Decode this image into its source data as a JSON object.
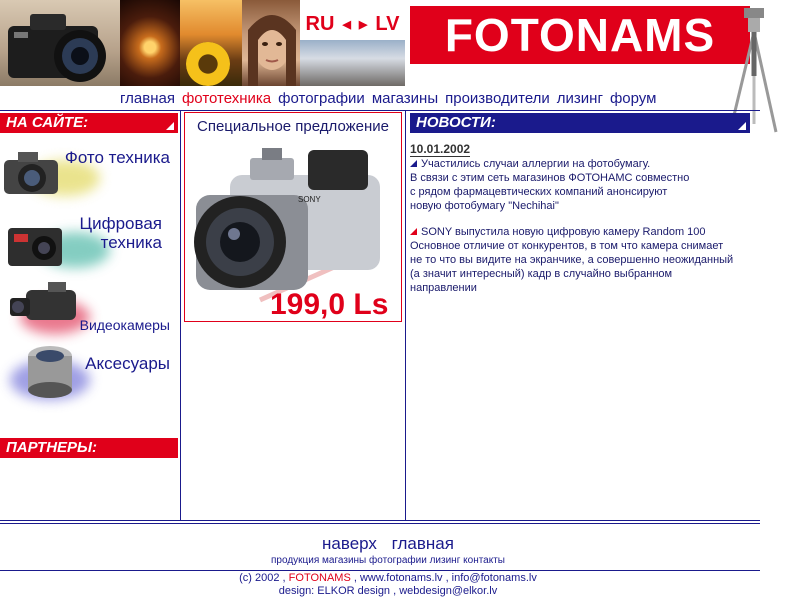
{
  "header": {
    "lang_ru": "RU",
    "lang_lv": "LV",
    "logo": "FOTONAMS"
  },
  "nav": [
    {
      "label": "главная",
      "active": false
    },
    {
      "label": "фототехника",
      "active": true
    },
    {
      "label": "фотографии",
      "active": false
    },
    {
      "label": "магазины",
      "active": false
    },
    {
      "label": "производители",
      "active": false
    },
    {
      "label": "лизинг",
      "active": false
    },
    {
      "label": "форум",
      "active": false
    }
  ],
  "sidebar": {
    "title": "НА САЙТЕ:",
    "items": [
      {
        "label": "Фото техника",
        "icon": "camera-icon"
      },
      {
        "label": "Цифровая техника",
        "icon": "digital-camera-icon"
      },
      {
        "label": "Видеокамеры",
        "icon": "video-camera-icon"
      },
      {
        "label": "Аксесуары",
        "icon": "lens-icon"
      }
    ],
    "partners_title": "ПАРТНЕРЫ:"
  },
  "offer": {
    "title": "Специальное предложение",
    "price": "199,0 Ls",
    "brand": "SONY"
  },
  "news": {
    "title": "НОВОСТИ:",
    "date": "10.01.2002",
    "items": [
      {
        "lines": [
          "Участились случаи аллергии на фотобумагу.",
          "В связи с этим сеть магазинов ФОТОНАМС совместно",
          "с рядом фармацевтических компаний анонсируют",
          "новую фотобумагу \"Nechihai\""
        ]
      },
      {
        "lines": [
          "SONY выпустила новую цифровую камеру Random 100",
          "Основное отличие от конкурентов, в том что камера снимает",
          "не то что вы видите на экранчике, а совершенно неожиданный",
          "(а значит интересный) кадр в случайно выбранном",
          "направлении"
        ]
      }
    ]
  },
  "footer": {
    "top": "наверх",
    "home": "главная",
    "links": [
      "продукция",
      "магазины",
      "фотографии",
      "лизинг",
      "контакты"
    ],
    "copyright_pre": "(c) 2002 ,",
    "copyright_brand": "FOTONAMS",
    "copyright_post": ", www.fotonams.lv ,   info@fotonams.lv",
    "design": "design: ELKOR design ,  webdesign@elkor.lv"
  },
  "colors": {
    "accent": "#e0001a",
    "navy": "#1a1a8c"
  }
}
